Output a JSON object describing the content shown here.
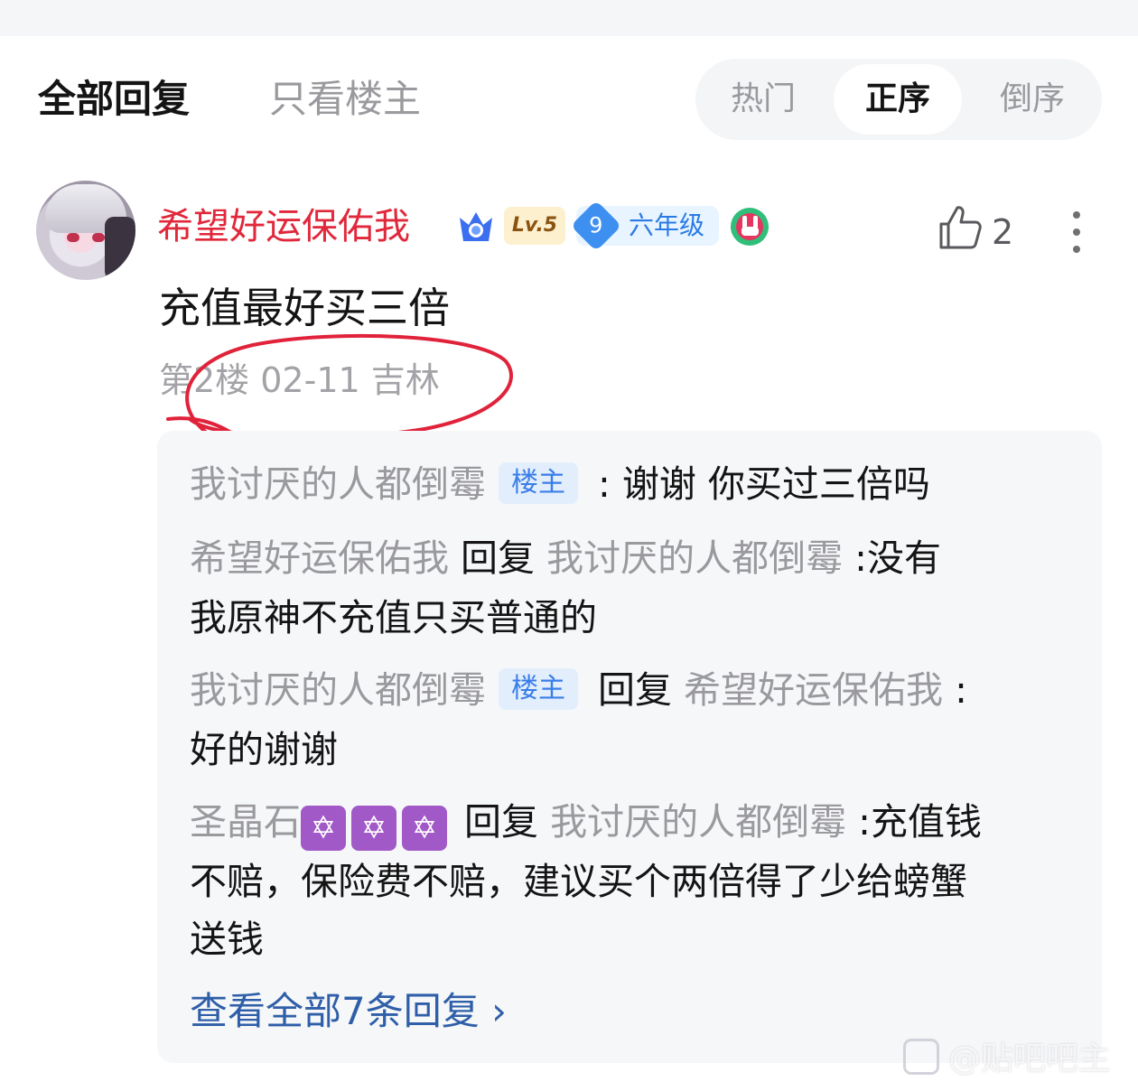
{
  "header": {
    "tab_all": "全部回复",
    "tab_owner_only": "只看楼主",
    "sort": {
      "hot": "热门",
      "asc": "正序",
      "desc": "倒序",
      "selected": "正序"
    }
  },
  "post": {
    "username": "希望好运保佑我",
    "level": "Lv.5",
    "grade_number": "9",
    "grade_text": "六年级",
    "likes": "2",
    "content": "充值最好买三倍",
    "meta": "第2楼 02-11 吉林"
  },
  "replies": [
    {
      "user": "我讨厌的人都倒霉",
      "tag": "楼主",
      "text": ": 谢谢 你买过三倍吗"
    },
    {
      "user": "希望好运保佑我",
      "reply_word": "回复",
      "target": "我讨厌的人都倒霉",
      "text_line1": " :没有",
      "text_line2": "我原神不充值只买普通的"
    },
    {
      "user": "我讨厌的人都倒霉",
      "tag": "楼主",
      "reply_word": "回复",
      "target": "希望好运保佑我",
      "text_line1": " :",
      "text_line2": "好的谢谢"
    },
    {
      "user": "圣晶石",
      "badge_glyph": "✡",
      "reply_word": "回复",
      "target": "我讨厌的人都倒霉",
      "text_line1": " :充值钱",
      "text_line2": "不赔，保险费不赔，建议买个两倍得了少给螃蟹",
      "text_line3": "送钱"
    }
  ],
  "view_all": "查看全部7条回复 ›",
  "watermark": "@贴吧吧主",
  "colors": {
    "username_red": "#e1283b",
    "link_blue": "#2f5fa8",
    "tag_blue": "#3a7ee8",
    "annotation_red": "#e0223a"
  }
}
